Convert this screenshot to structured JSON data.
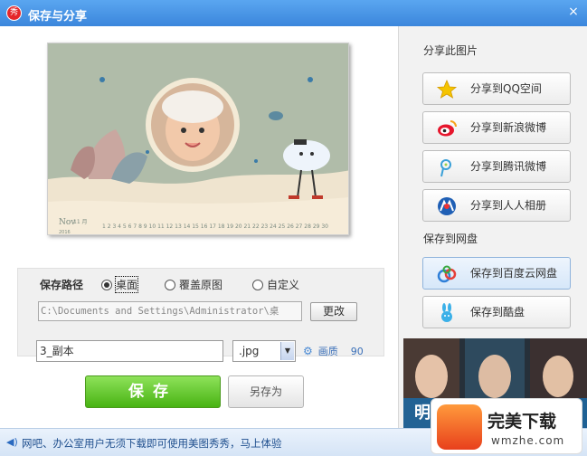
{
  "window": {
    "title": "保存与分享",
    "logo_text": "秀",
    "close_glyph": "×"
  },
  "preview": {
    "calendar_month": "Nov",
    "calendar_year": "2016",
    "calendar_month_cn": "11\n月",
    "calendar_days": "1 2 3 4 5 6 7 8 9 10 11 12 13 14 15 16 17 18 19 20 21 22 23 24 25 26 27 28 29 30"
  },
  "save_path": {
    "label": "保存路径",
    "options": [
      {
        "label": "桌面",
        "selected": true
      },
      {
        "label": "覆盖原图",
        "selected": false
      },
      {
        "label": "自定义",
        "selected": false
      }
    ],
    "path_value": "C:\\Documents and Settings\\Administrator\\桌",
    "change_button": "更改"
  },
  "file": {
    "name_value": "3_副本",
    "extension": ".jpg",
    "quality_label": "画质",
    "quality_value": "90"
  },
  "actions": {
    "save": "保存",
    "save_as": "另存为"
  },
  "share": {
    "title": "分享此图片",
    "items": [
      {
        "label": "分享到QQ空间",
        "icon": "qzone-star-icon"
      },
      {
        "label": "分享到新浪微博",
        "icon": "weibo-icon"
      },
      {
        "label": "分享到腾讯微博",
        "icon": "tencent-weibo-icon"
      },
      {
        "label": "分享到人人相册",
        "icon": "renren-icon"
      }
    ]
  },
  "cloud": {
    "title": "保存到网盘",
    "items": [
      {
        "label": "保存到百度云网盘",
        "icon": "baidu-cloud-icon"
      },
      {
        "label": "保存到酷盘",
        "icon": "kupan-rabbit-icon"
      }
    ]
  },
  "ad": {
    "text": "明星 直播"
  },
  "status": {
    "message": "网吧、办公室用户无须下载即可使用美图秀秀，马上体验"
  },
  "watermark": {
    "name": "完美下载",
    "url": "wmzhe.com"
  },
  "colors": {
    "titlebar": "#3b86dc",
    "save_button": "#48b313",
    "link": "#3a6fb8"
  }
}
